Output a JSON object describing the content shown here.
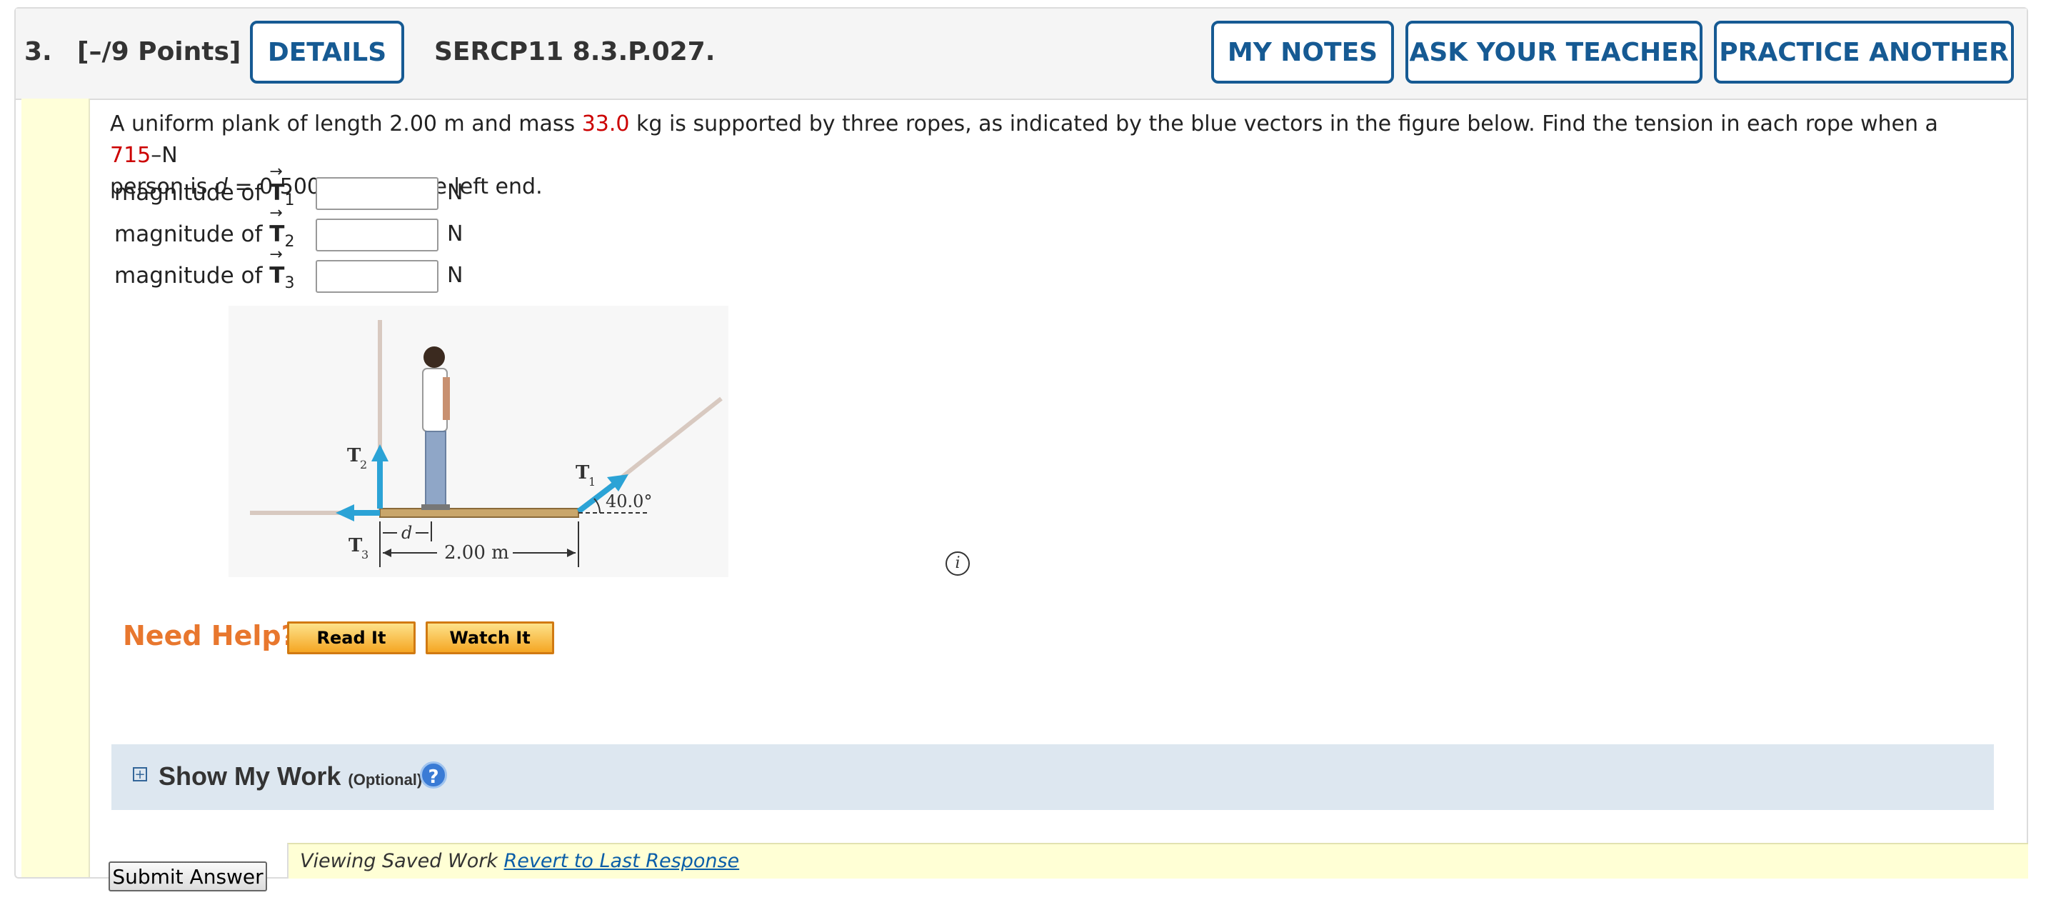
{
  "header": {
    "question_number": "3.",
    "points": "[–/9 Points]",
    "details_label": "DETAILS",
    "problem_code": "SERCP11 8.3.P.027.",
    "my_notes_label": "MY NOTES",
    "ask_teacher_label": "ASK YOUR TEACHER",
    "practice_label": "PRACTICE ANOTHER"
  },
  "question": {
    "t1": "A uniform plank of length 2.00 m and mass ",
    "mass": "33.0",
    "t2": " kg is supported by three ropes, as indicated by the blue vectors in the figure below. Find the tension in each rope when a ",
    "weight": "715",
    "t3": "–N",
    "t4": "person is ",
    "d_var": "d",
    "t5": " = 0.500 m from the left end."
  },
  "answers": [
    {
      "label": "magnitude of ",
      "symbol": "T",
      "sub": "1",
      "unit": "N",
      "value": ""
    },
    {
      "label": "magnitude of ",
      "symbol": "T",
      "sub": "2",
      "unit": "N",
      "value": ""
    },
    {
      "label": "magnitude of ",
      "symbol": "T",
      "sub": "3",
      "unit": "N",
      "value": ""
    }
  ],
  "figure": {
    "t2_label": "T",
    "t2_sub": "2",
    "t1_label": "T",
    "t1_sub": "1",
    "t3_label": "T",
    "t3_sub": "3",
    "angle_label": "40.0°",
    "d_label": "d",
    "length_label": "2.00 m",
    "info_icon": "i"
  },
  "help": {
    "need_help": "Need Help?",
    "read_it": "Read It",
    "watch_it": "Watch It"
  },
  "work": {
    "plus": "+",
    "label": "Show My Work",
    "optional": "(Optional)",
    "help_icon": "?"
  },
  "saved": {
    "text": "Viewing Saved Work ",
    "link": "Revert to Last Response"
  },
  "submit_label": "Submit Answer",
  "colors": {
    "accent": "#165a93",
    "highlight_red": "#cc0000",
    "need_help_orange": "#e8772e",
    "vector_blue": "#2ba3d6"
  }
}
